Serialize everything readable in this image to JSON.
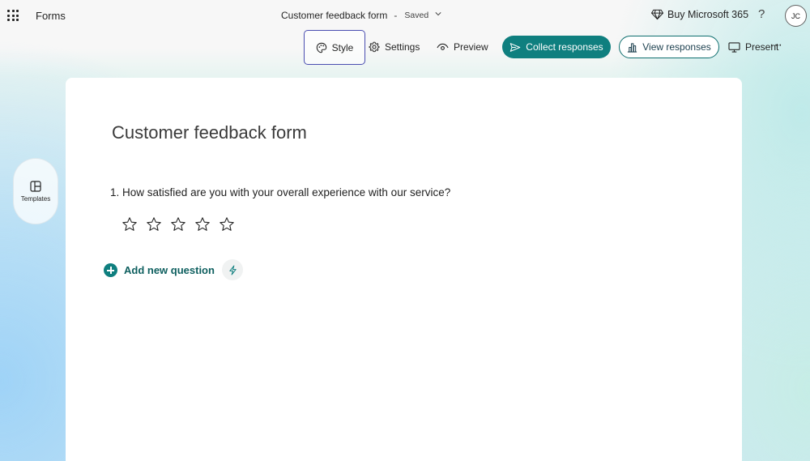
{
  "app": {
    "name": "Forms"
  },
  "document": {
    "title": "Customer feedback form",
    "separator": "-",
    "status": "Saved"
  },
  "header": {
    "buy_label": "Buy Microsoft 365",
    "help_label": "?",
    "avatar_initials": "JC"
  },
  "toolbar": {
    "style_label": "Style",
    "settings_label": "Settings",
    "preview_label": "Preview",
    "collect_label": "Collect responses",
    "view_label": "View responses",
    "present_label": "Present",
    "more_label": "···"
  },
  "sidebar": {
    "templates_label": "Templates"
  },
  "form": {
    "title": "Customer feedback form",
    "questions": [
      {
        "number": "1.",
        "text": "How satisfied are you with your overall experience with our service?",
        "type": "rating",
        "max_stars": 5
      }
    ],
    "add_question_label": "Add new question"
  },
  "colors": {
    "accent": "#0f7f7f",
    "style_focus": "#4a4db0"
  }
}
